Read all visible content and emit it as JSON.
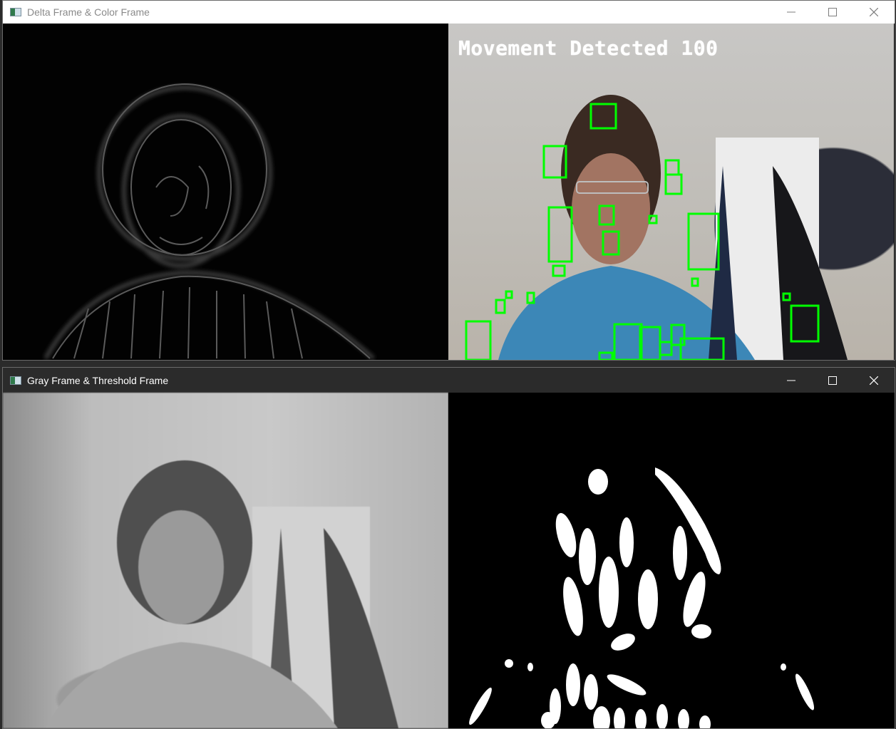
{
  "windows": [
    {
      "title": "Delta Frame & Color Frame",
      "controls": {
        "minimize": "minimize-icon",
        "maximize": "maximize-icon",
        "close": "close-icon"
      }
    },
    {
      "title": "Gray Frame & Threshold Frame",
      "controls": {
        "minimize": "minimize-icon",
        "maximize": "maximize-icon",
        "close": "close-icon"
      }
    }
  ],
  "color_frame": {
    "overlay_text": "Movement Detected 100",
    "box_color": "#00ff00",
    "text_color": "#ffffff"
  },
  "colors": {
    "titlebar_light": "#ffffff",
    "titlebar_dark": "#2b2b2b",
    "threshold_fg": "#ffffff",
    "threshold_bg": "#000000"
  }
}
